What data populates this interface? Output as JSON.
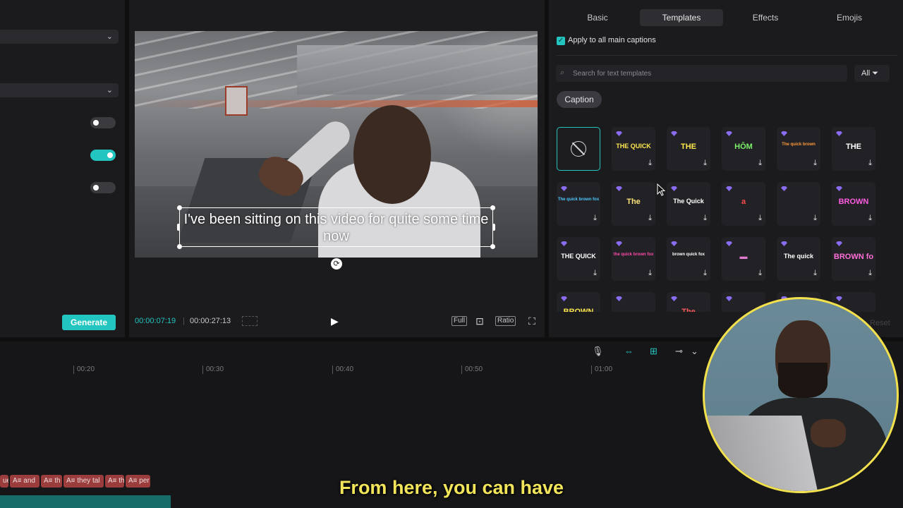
{
  "left_panel": {
    "generate_label": "Generate",
    "toggles": [
      false,
      true,
      false
    ]
  },
  "player": {
    "caption_text": "I've been sitting on this video for quite some time now",
    "current_time": "00:00:07:19",
    "separator": "|",
    "total_time": "00:00:27:13",
    "buttons": {
      "full": "Full",
      "ratio": "Ratio"
    }
  },
  "right_panel": {
    "tabs": [
      "Basic",
      "Templates",
      "Effects",
      "Emojis"
    ],
    "active_tab": "Templates",
    "apply_all_label": "Apply to all main captions",
    "search_placeholder": "Search for text templates",
    "filter_label": "All",
    "category_chip": "Caption",
    "reset_label": "Reset",
    "templates": [
      {
        "text": "",
        "none": true
      },
      {
        "text": "THE QUICK",
        "color": "#ffe94d"
      },
      {
        "text": "THE",
        "color": "#ffe94d"
      },
      {
        "text": "HÔM",
        "color": "#7cf06a"
      },
      {
        "text": "The quick brown",
        "color": "#ff9a3c"
      },
      {
        "text": "THE",
        "color": "#ffffff"
      },
      {
        "text": "The quick brown fox",
        "color": "#4ec7ff"
      },
      {
        "text": "The",
        "color": "#ffe27a"
      },
      {
        "text": "The Quick",
        "color": "#ffffff"
      },
      {
        "text": "a",
        "color": "#ff4a4a"
      },
      {
        "text": "",
        "color": "#ff4a4a"
      },
      {
        "text": "BROWN",
        "color": "#ff5ce1"
      },
      {
        "text": "THE QUICK",
        "color": "#ffffff"
      },
      {
        "text": "the quick brown fox",
        "color": "#ff4aa8"
      },
      {
        "text": "brown quick fox",
        "color": "#ffffff"
      },
      {
        "text": "▬",
        "color": "#e07ad0"
      },
      {
        "text": "The quick",
        "color": "#ffffff"
      },
      {
        "text": "BROWN fo",
        "color": "#ff6fd8"
      },
      {
        "text": "BROWN",
        "color": "#ffe94d"
      },
      {
        "text": "",
        "color": "#ffffff"
      },
      {
        "text": "The",
        "color": "#ff5a5a"
      },
      {
        "text": "",
        "color": "#ffffff"
      },
      {
        "text": "",
        "color": "#ffffff"
      },
      {
        "text": "",
        "color": "#ffffff"
      }
    ]
  },
  "timeline": {
    "ruler": [
      "00:20",
      "00:30",
      "00:40",
      "00:50",
      "01:00"
    ],
    "caption_clips": [
      "ue",
      "A≡ and",
      "A≡ th",
      "A≡ they tal",
      "A≡ th",
      "A≡ per"
    ]
  },
  "subtitle": "From here, you can have",
  "colors": {
    "accent": "#22c5c0",
    "subtitle": "#f3e55a",
    "webcam_ring": "#f2e14c"
  }
}
